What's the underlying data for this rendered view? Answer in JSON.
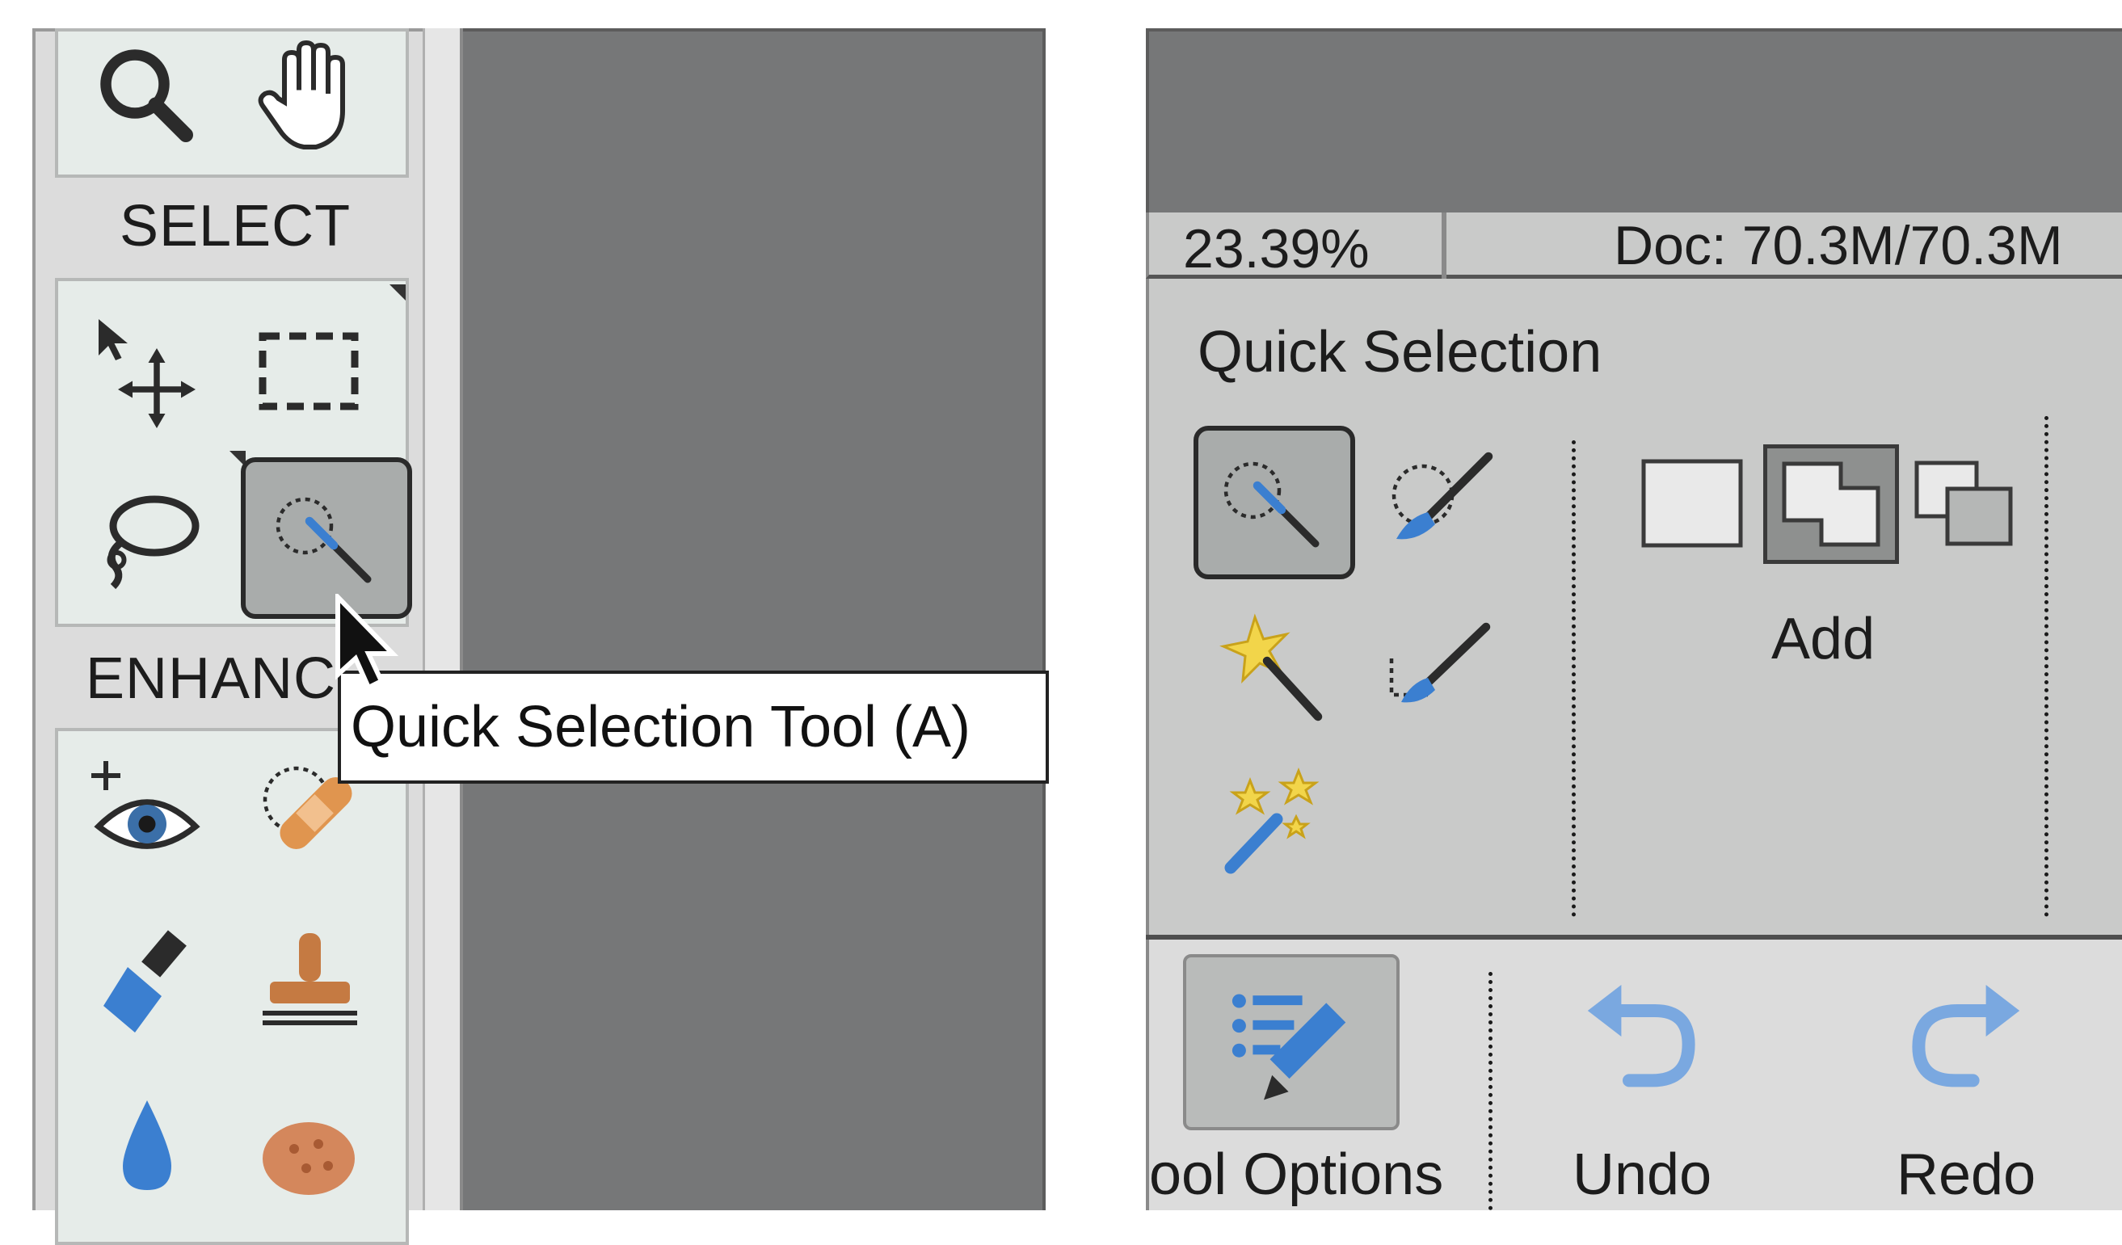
{
  "toolbar": {
    "sections": {
      "select": "SELECT",
      "enhance": "ENHANC"
    },
    "view_tools": [
      "zoom-icon",
      "hand-icon"
    ],
    "select_tools": [
      "move-icon",
      "rectangular-marquee-icon",
      "lasso-icon",
      "quick-selection-icon"
    ],
    "enhance_tools": [
      "red-eye-removal-icon",
      "spot-healing-brush-icon",
      "smart-brush-icon",
      "clone-stamp-icon",
      "blur-icon",
      "sponge-icon"
    ],
    "selected_tool": "quick-selection-icon"
  },
  "tooltip": {
    "text": "Quick Selection Tool (A)"
  },
  "status_bar": {
    "zoom": "23.39%",
    "doc_size": "Doc: 70.3M/70.3M"
  },
  "tool_options": {
    "title": "Quick Selection",
    "tools": [
      "quick-selection-icon",
      "selection-brush-icon",
      "magic-wand-icon",
      "refine-selection-brush-icon",
      "auto-selection-icon"
    ],
    "selected_tool": "quick-selection-icon",
    "modes": [
      "new-selection-icon",
      "add-to-selection-icon",
      "subtract-from-selection-icon"
    ],
    "selected_mode_label": "Add"
  },
  "bottom_bar": {
    "tool_options_label": "ool Options",
    "undo_label": "Undo",
    "redo_label": "Redo"
  },
  "colors": {
    "canvas_gray": "#767778",
    "panel_gray": "#c9cac9",
    "toolbar_bg": "#e6ece9",
    "accent_blue": "#3b7fd0"
  }
}
